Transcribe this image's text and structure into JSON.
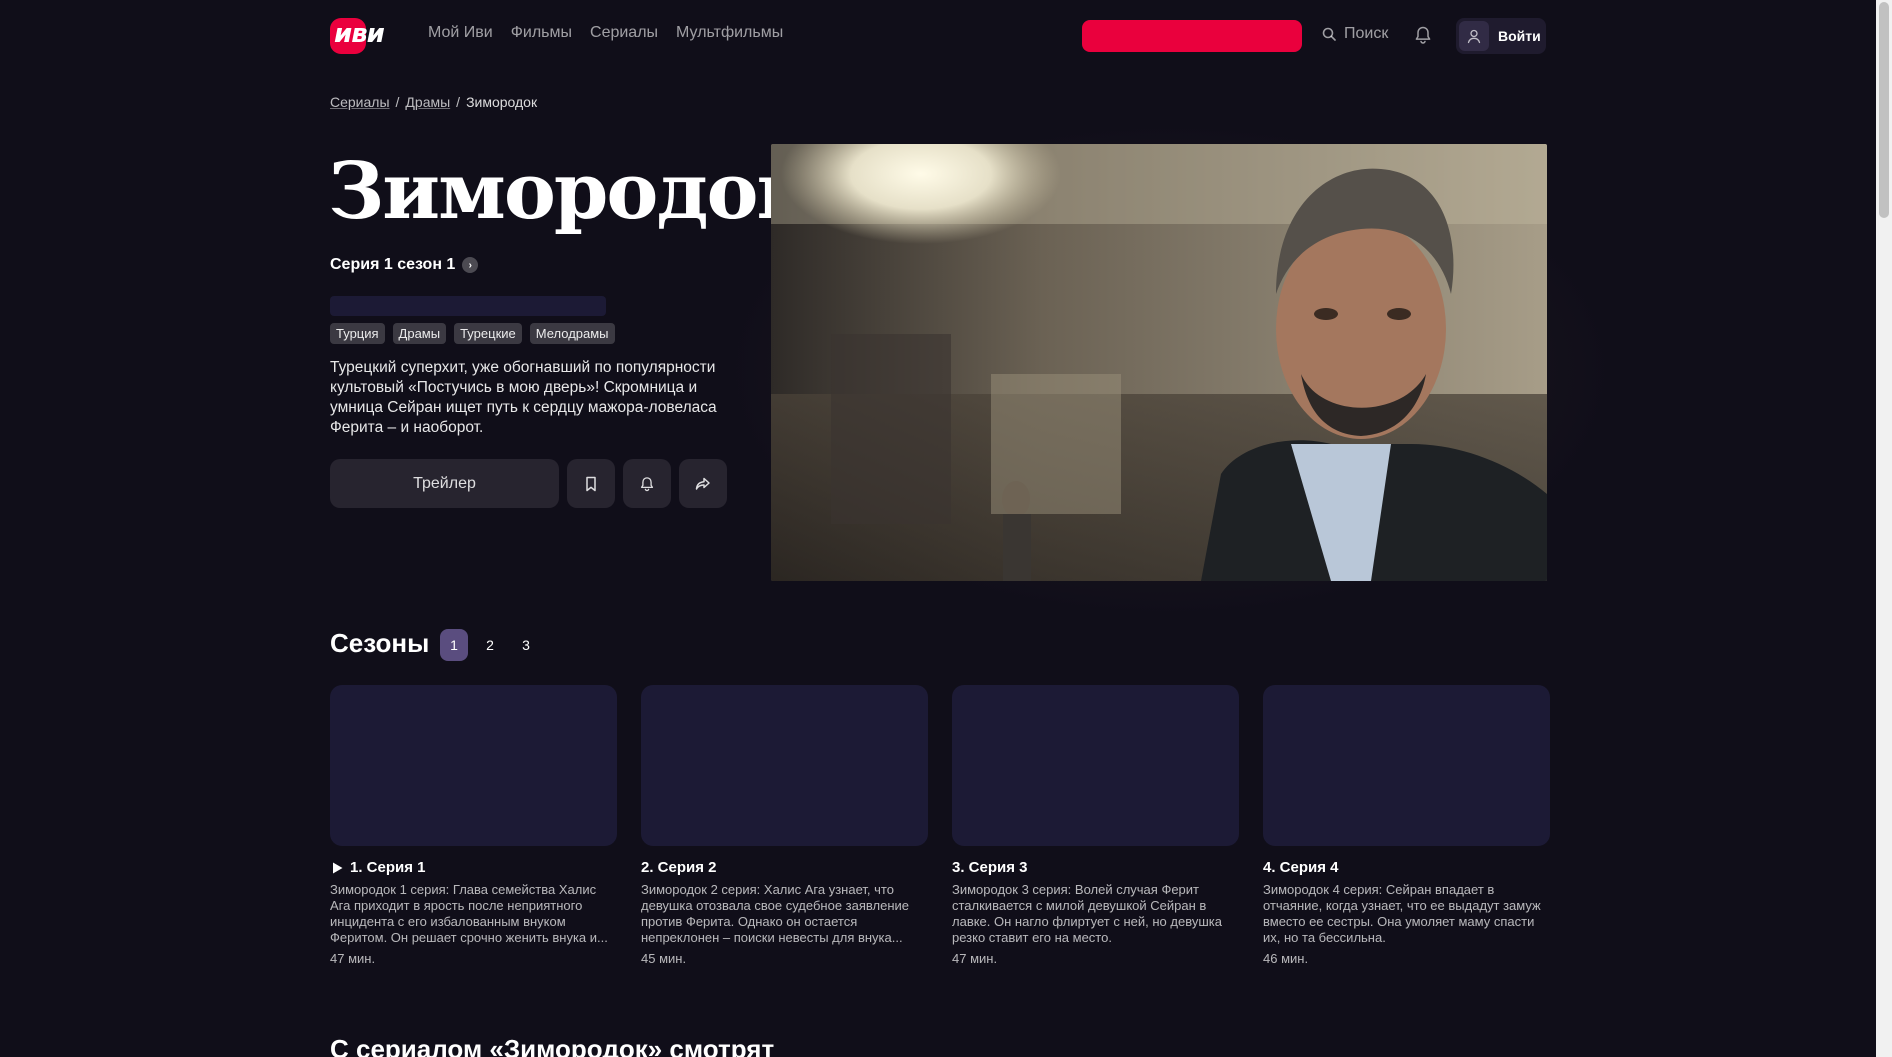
{
  "header": {
    "logo_text": "иви",
    "nav": [
      "Мой Иви",
      "Фильмы",
      "Сериалы",
      "Мультфильмы"
    ],
    "search_label": "Поиск",
    "login_label": "Войти",
    "brand_color": "#ea003d"
  },
  "breadcrumb": {
    "items": [
      "Сериалы",
      "Драмы"
    ],
    "current": "Зимородок",
    "separator": "/"
  },
  "hero": {
    "title": "Зимородок",
    "series_link": "Серия 1 сезон 1",
    "genres": [
      "Турция",
      "Драмы",
      "Турецкие",
      "Мелодрамы"
    ],
    "description": "Турецкий суперхит, уже обогнавший по популярности культовый «Постучись в мою дверь»! Скромница и умница Сейран ищет путь к сердцу мажора-ловеласа Ферита – и наоборот.",
    "trailer_label": "Трейлер"
  },
  "seasons": {
    "title": "Сезоны",
    "tabs": [
      "1",
      "2",
      "3"
    ],
    "active": "1"
  },
  "episodes": [
    {
      "title": "1. Серия 1",
      "description": "Зимородок 1 серия: Глава семейства Халис Ага приходит в ярость после неприятного инцидента с его избалованным внуком Феритом. Он решает срочно женить внука и...",
      "duration": "47 мин."
    },
    {
      "title": "2. Серия 2",
      "description": "Зимородок 2 серия: Халис Ага узнает, что девушка отозвала свое судебное заявление против Ферита. Однако он остается непреклонен – поиски невесты для внука...",
      "duration": "45 мин."
    },
    {
      "title": "3. Серия 3",
      "description": "Зимородок 3 серия: Волей случая Ферит сталкивается с милой девушкой Сейран в лавке. Он нагло флиртует с ней, но девушка резко ставит его на место.",
      "duration": "47 мин."
    },
    {
      "title": "4. Серия 4",
      "description": "Зимородок 4 серия: Сейран впадает в отчаяние, когда узнает, что ее выдадут замуж вместо ее сестры. Она умоляет маму спасти их, но та бессильна.",
      "duration": "46 мин."
    }
  ],
  "also_watch_title": "С сериалом «Зимородок» смотрят"
}
